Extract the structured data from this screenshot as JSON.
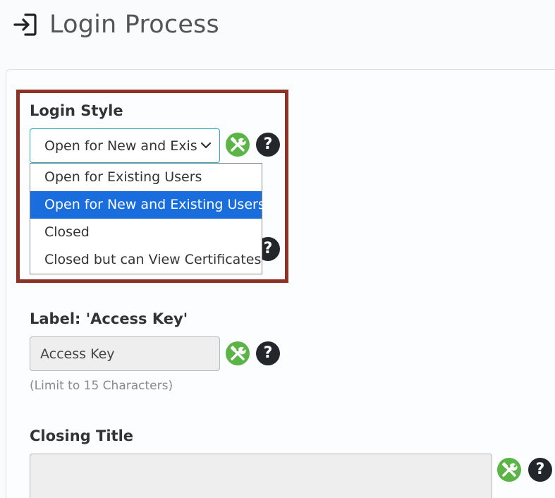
{
  "page": {
    "title": "Login Process",
    "title_icon": "login-arrow-icon"
  },
  "login_style": {
    "label": "Login Style",
    "selected_value": "Open for New and Exis",
    "options": [
      "Open for Existing Users",
      "Open for New and Existing Users",
      "Closed",
      "Closed but can View Certificates"
    ],
    "selected_index": 1
  },
  "access_key": {
    "label": "Label: 'Access Key'",
    "value": "Access Key",
    "hint": "(Limit to 15 Characters)"
  },
  "closing_title": {
    "label": "Closing Title",
    "value": ""
  },
  "icons": {
    "tool": "tools-icon",
    "help": "help-icon",
    "help_glyph": "?"
  },
  "colors": {
    "highlight_border": "#8e3226",
    "selected_option": "#1a6ddc",
    "tool_icon": "#5bb446",
    "help_icon": "#23262b",
    "select_border": "#2aa7c8"
  }
}
